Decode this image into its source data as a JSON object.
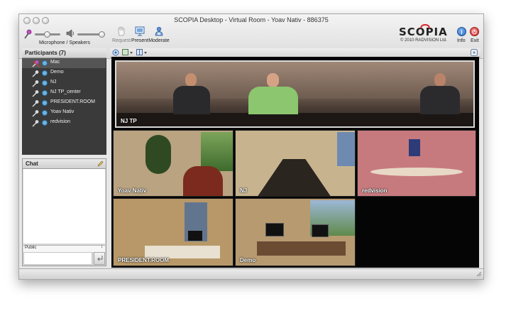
{
  "window": {
    "title": "SCOPIA Desktop - Virtual Room - Yoav Nativ - 886375"
  },
  "toolbar": {
    "audio_label": "Microphone / Speakers",
    "microphone_level": 0.55,
    "speaker_level": 1.0,
    "request_label": "Request",
    "present_label": "Present",
    "moderate_label": "Moderate",
    "logo_text": "SCOPIA",
    "copyright": "© 2010 RADVISION Ltd.",
    "info_label": "Info",
    "exit_label": "Exit"
  },
  "participants": {
    "header": "Participants (7)",
    "items": [
      {
        "name": "Mac",
        "muted": true
      },
      {
        "name": "Demo",
        "muted": false
      },
      {
        "name": "NJ",
        "muted": false
      },
      {
        "name": "NJ TP_center",
        "muted": false
      },
      {
        "name": "PRESIDENT.ROOM",
        "muted": false
      },
      {
        "name": "Yoav Nativ",
        "muted": false
      },
      {
        "name": "redvision",
        "muted": false
      }
    ]
  },
  "chat": {
    "header": "Chat",
    "recipient": "Public"
  },
  "video": {
    "tiles": [
      {
        "label": "NJ TP"
      },
      {
        "label": "Yoav Nativ"
      },
      {
        "label": "NJ"
      },
      {
        "label": "redvision"
      },
      {
        "label": "PRESIDENT.ROOM"
      },
      {
        "label": "Demo"
      }
    ]
  },
  "colors": {
    "panel_dark": "#3a3a3a",
    "logo_accent": "#d4252b",
    "info_blue": "#2a6fc9",
    "exit_red": "#cf2b2b"
  }
}
